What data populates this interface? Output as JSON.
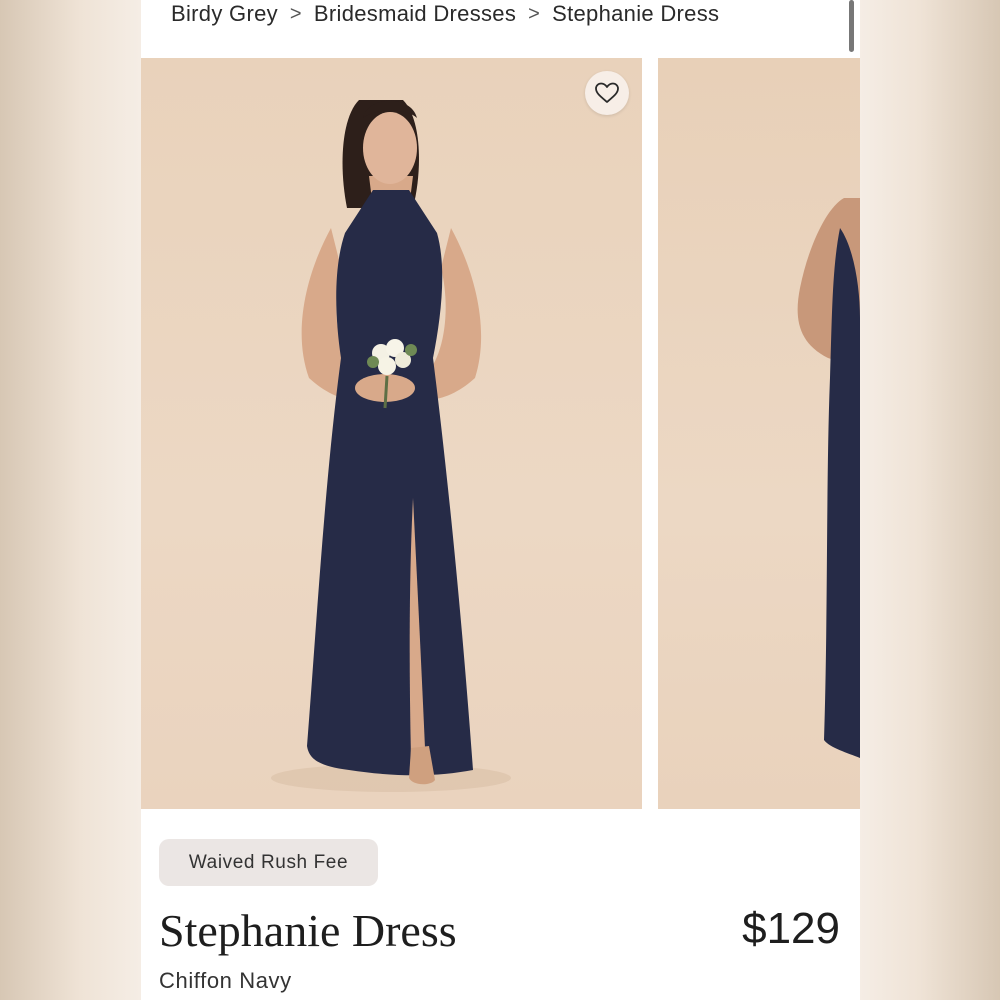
{
  "breadcrumb": {
    "items": [
      "Birdy Grey",
      "Bridesmaid Dresses",
      "Stephanie Dress"
    ],
    "separator": ">"
  },
  "gallery": {
    "favorite_icon": "heart-outline-icon"
  },
  "product": {
    "badge": "Waived Rush Fee",
    "title": "Stephanie Dress",
    "price": "$129",
    "subtitle": "Chiffon Navy"
  },
  "colors": {
    "dress": "#262b47",
    "photo_background": "#ead3be"
  }
}
